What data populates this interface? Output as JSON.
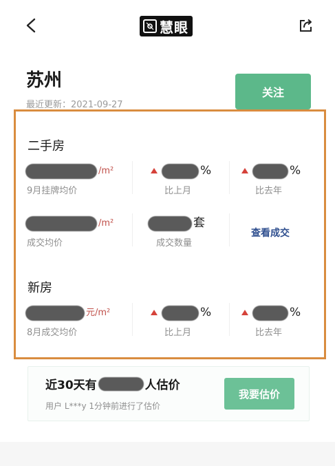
{
  "header": {
    "logo_text": "慧眼",
    "icons": {
      "back": "chevron-left-icon",
      "share": "share-icon",
      "logo": "logo-icon"
    }
  },
  "city": {
    "name": "苏州",
    "update_label": "最近更新：",
    "update_date": "2021-09-27",
    "follow_label": "关注"
  },
  "second_hand": {
    "title": "二手房",
    "listing_price": {
      "unit": "/m²",
      "label": "9月挂牌均价"
    },
    "mom": {
      "suffix": "%",
      "label": "比上月",
      "trend": "up"
    },
    "yoy": {
      "suffix": "%",
      "label": "比去年",
      "trend": "up"
    },
    "deal_price": {
      "unit": "/m²",
      "label": "成交均价"
    },
    "deal_count": {
      "suffix": "套",
      "label": "成交数量"
    },
    "view_deals_label": "查看成交"
  },
  "new_house": {
    "title": "新房",
    "deal_price": {
      "unit": "元/m²",
      "label": "8月成交均价"
    },
    "mom": {
      "suffix": "%",
      "label": "比上月",
      "trend": "up"
    },
    "yoy": {
      "suffix": "%",
      "label": "比去年",
      "trend": "up"
    }
  },
  "estimate": {
    "title_prefix": "近30天有",
    "title_suffix": "人估价",
    "subtitle": "用户 L***y 1分钟前进行了估价",
    "button_label": "我要估价"
  },
  "colors": {
    "accent_green": "#5cb88a",
    "highlight_border": "#d98c3f",
    "up_red": "#d5423a",
    "link_blue": "#2f4f8f"
  }
}
